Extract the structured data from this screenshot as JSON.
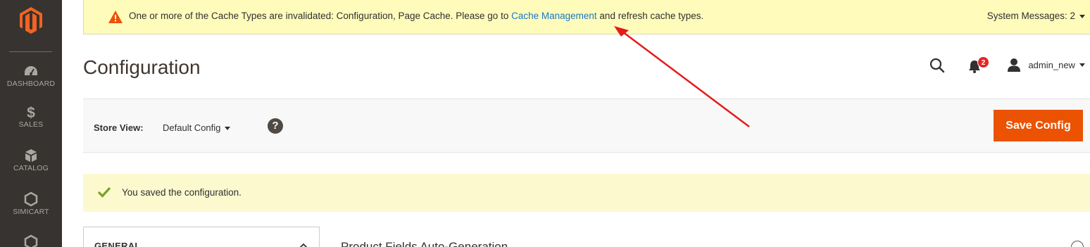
{
  "sidebar": {
    "logo": "magento-logo",
    "items": [
      {
        "label": "DASHBOARD",
        "icon": "dashboard-icon"
      },
      {
        "label": "SALES",
        "icon": "dollar-icon"
      },
      {
        "label": "CATALOG",
        "icon": "box-icon"
      },
      {
        "label": "SIMICART",
        "icon": "hexagon-icon"
      },
      {
        "label": "",
        "icon": "hexagon-icon"
      }
    ]
  },
  "system_message": {
    "text_before": "One or more of the Cache Types are invalidated: Configuration, Page Cache. Please go to ",
    "link_text": "Cache Management",
    "text_after": " and refresh cache types.",
    "count_label": "System Messages: 2"
  },
  "header": {
    "title": "Configuration",
    "notification_count": "2",
    "user_name": "admin_new"
  },
  "toolbar": {
    "store_view_label": "Store View:",
    "store_view_value": "Default Config",
    "help_symbol": "?",
    "save_label": "Save Config"
  },
  "success_message": {
    "text": "You saved the configuration."
  },
  "tabs": {
    "general_title": "GENERAL"
  },
  "section": {
    "title": "Product Fields Auto-Generation"
  },
  "colors": {
    "sidebar_bg": "#373330",
    "accent": "#eb5202",
    "link": "#1979c3",
    "message_bg": "#fffbbb",
    "annotation_arrow": "#e31b1b"
  }
}
